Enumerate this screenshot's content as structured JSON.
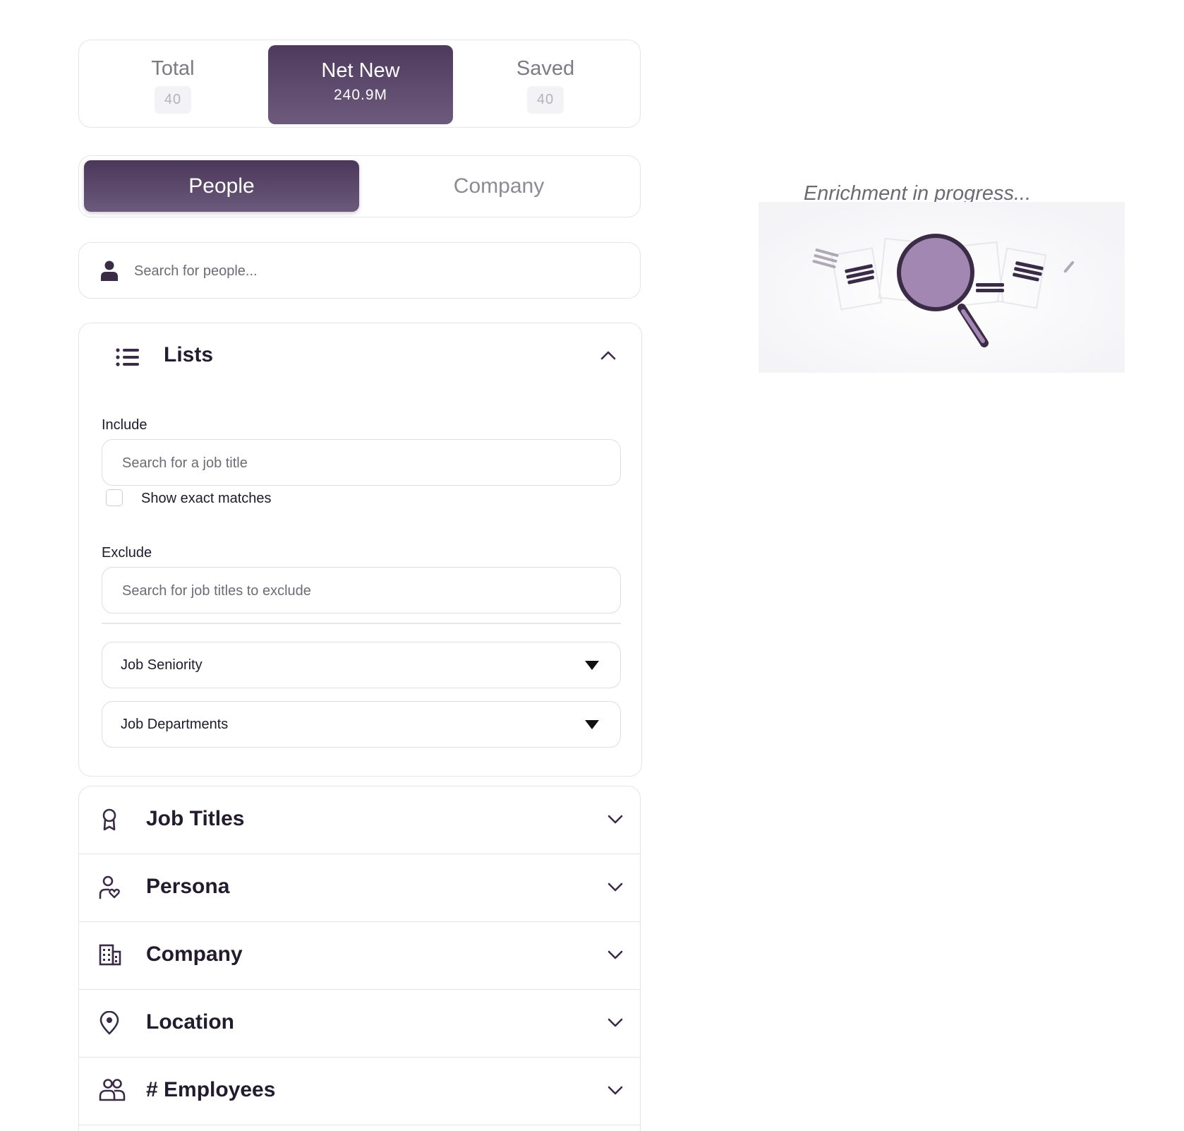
{
  "stats": {
    "total": {
      "label": "Total",
      "value": "40"
    },
    "net_new": {
      "label": "Net New",
      "value": "240.9M"
    },
    "saved": {
      "label": "Saved",
      "value": "40"
    }
  },
  "mode": {
    "people": "People",
    "company": "Company"
  },
  "search": {
    "placeholder": "Search for people..."
  },
  "lists": {
    "title": "Lists",
    "include_label": "Include",
    "include_placeholder": "Search for a job title",
    "exact_label": "Show exact matches",
    "exclude_label": "Exclude",
    "exclude_placeholder": "Search for job titles to exclude",
    "dropdowns": [
      "Job Seniority",
      "Job Departments"
    ]
  },
  "accordion": [
    {
      "label": "Job Titles",
      "icon": "badge-icon"
    },
    {
      "label": "Persona",
      "icon": "persona-icon"
    },
    {
      "label": "Company",
      "icon": "building-icon"
    },
    {
      "label": "Location",
      "icon": "location-pin-icon"
    },
    {
      "label": "# Employees",
      "icon": "users-icon"
    }
  ],
  "enrichment": {
    "text": "Enrichment in progress..."
  },
  "colors": {
    "accent": "#4d3a5c",
    "accent_light": "#a387b3",
    "border": "#e5e4ea"
  }
}
